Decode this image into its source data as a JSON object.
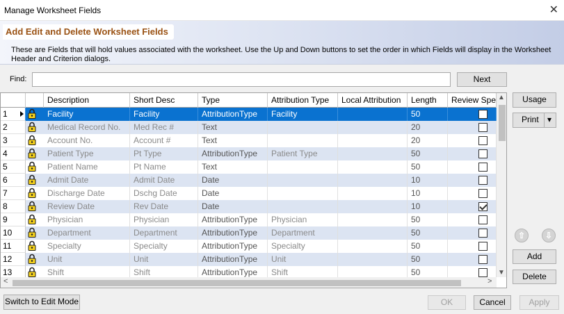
{
  "window": {
    "title": "Manage Worksheet Fields",
    "close_glyph": "✕"
  },
  "banner": {
    "heading": "Add Edit and Delete Worksheet Fields",
    "description": "These are Fields that will hold values associated with the worksheet. Use the Up and Down buttons to set the order in which Fields will display in the Worksheet Header and Criterion dialogs."
  },
  "find": {
    "label": "Find:",
    "value": "",
    "next_label": "Next"
  },
  "grid": {
    "columns": [
      "Description",
      "Short Desc",
      "Type",
      "Attribution Type",
      "Local Attribution",
      "Length",
      "Review Spec"
    ],
    "rows": [
      {
        "num": "1",
        "description": "Facility",
        "short": "Facility",
        "type": "AttributionType",
        "attr": "Facility",
        "local": "",
        "length": "50",
        "review": false,
        "selected": true
      },
      {
        "num": "2",
        "description": "Medical Record No.",
        "short": "Med Rec #",
        "type": "Text",
        "attr": "",
        "local": "",
        "length": "20",
        "review": false
      },
      {
        "num": "3",
        "description": "Account No.",
        "short": "Account #",
        "type": "Text",
        "attr": "",
        "local": "",
        "length": "20",
        "review": false
      },
      {
        "num": "4",
        "description": "Patient Type",
        "short": "Pt Type",
        "type": "AttributionType",
        "attr": "Patient Type",
        "local": "",
        "length": "50",
        "review": false
      },
      {
        "num": "5",
        "description": "Patient Name",
        "short": "Pt Name",
        "type": "Text",
        "attr": "",
        "local": "",
        "length": "50",
        "review": false
      },
      {
        "num": "6",
        "description": "Admit Date",
        "short": "Admit Date",
        "type": "Date",
        "attr": "",
        "local": "",
        "length": "10",
        "review": false
      },
      {
        "num": "7",
        "description": "Discharge Date",
        "short": "Dschg Date",
        "type": "Date",
        "attr": "",
        "local": "",
        "length": "10",
        "review": false
      },
      {
        "num": "8",
        "description": "Review Date",
        "short": "Rev Date",
        "type": "Date",
        "attr": "",
        "local": "",
        "length": "10",
        "review": true
      },
      {
        "num": "9",
        "description": "Physician",
        "short": "Physician",
        "type": "AttributionType",
        "attr": "Physician",
        "local": "",
        "length": "50",
        "review": false
      },
      {
        "num": "10",
        "description": "Department",
        "short": "Department",
        "type": "AttributionType",
        "attr": "Department",
        "local": "",
        "length": "50",
        "review": false
      },
      {
        "num": "11",
        "description": "Specialty",
        "short": "Specialty",
        "type": "AttributionType",
        "attr": "Specialty",
        "local": "",
        "length": "50",
        "review": false
      },
      {
        "num": "12",
        "description": "Unit",
        "short": "Unit",
        "type": "AttributionType",
        "attr": "Unit",
        "local": "",
        "length": "50",
        "review": false
      },
      {
        "num": "13",
        "description": "Shift",
        "short": "Shift",
        "type": "AttributionType",
        "attr": "Shift",
        "local": "",
        "length": "50",
        "review": false
      }
    ]
  },
  "side": {
    "usage_label": "Usage",
    "print_label": "Print",
    "print_arrow": "▾",
    "add_label": "Add",
    "delete_label": "Delete",
    "up_glyph": "⇧",
    "down_glyph": "⇩"
  },
  "footer": {
    "switch_label": "Switch to Edit Mode",
    "ok_label": "OK",
    "cancel_label": "Cancel",
    "apply_label": "Apply"
  },
  "colors": {
    "heading": "#9a5214",
    "selected_row": "#0a72d0",
    "alt_row": "#dce4f2"
  }
}
